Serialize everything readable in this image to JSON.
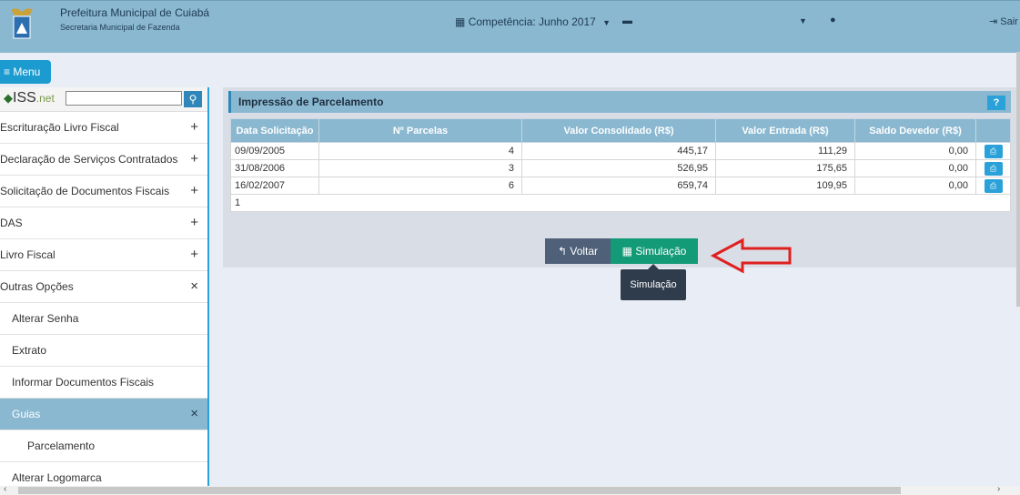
{
  "header": {
    "org_name": "Prefeitura Municipal de Cuiabá",
    "org_sub": "Secretaria Municipal de Fazenda",
    "competencia": "Competência: Junho 2017",
    "logout": "Sair"
  },
  "menu_button": "≡ Menu",
  "iss": {
    "brand": "ISS",
    "brand_suffix": ".net",
    "search_value": ""
  },
  "sidebar": {
    "items": [
      {
        "label": "Escrituração Livro Fiscal",
        "sign": "+"
      },
      {
        "label": "Declaração de Serviços Contratados",
        "sign": "+"
      },
      {
        "label": "Solicitação de Documentos Fiscais",
        "sign": "+"
      },
      {
        "label": "DAS",
        "sign": "+"
      },
      {
        "label": "Livro Fiscal",
        "sign": "+"
      },
      {
        "label": "Outras Opções",
        "sign": "×"
      },
      {
        "label": "Alterar Senha",
        "sign": ""
      },
      {
        "label": "Extrato",
        "sign": ""
      },
      {
        "label": "Informar Documentos Fiscais",
        "sign": ""
      },
      {
        "label": "Guias",
        "sign": "×"
      },
      {
        "label": "Parcelamento",
        "sign": ""
      },
      {
        "label": "Alterar Logomarca",
        "sign": ""
      }
    ]
  },
  "panel": {
    "title": "Impressão de Parcelamento",
    "help": "?",
    "columns": [
      "Data Solicitação",
      "Nº Parcelas",
      "Valor Consolidado (R$)",
      "Valor Entrada (R$)",
      "Saldo Devedor (R$)",
      ""
    ],
    "rows": [
      {
        "data": "09/09/2005",
        "parcelas": "4",
        "consolidado": "445,17",
        "entrada": "111,29",
        "saldo": "0,00"
      },
      {
        "data": "31/08/2006",
        "parcelas": "3",
        "consolidado": "526,95",
        "entrada": "175,65",
        "saldo": "0,00"
      },
      {
        "data": "16/02/2007",
        "parcelas": "6",
        "consolidado": "659,74",
        "entrada": "109,95",
        "saldo": "0,00"
      }
    ],
    "pager": "1",
    "btn_voltar": "Voltar",
    "btn_simulacao": "Simulação",
    "tooltip": "Simulação"
  },
  "colors": {
    "header": "#8ab8d0",
    "accent": "#2aa1d8",
    "green": "#139a77",
    "slate": "#4f6178",
    "arrow": "#e02020"
  }
}
